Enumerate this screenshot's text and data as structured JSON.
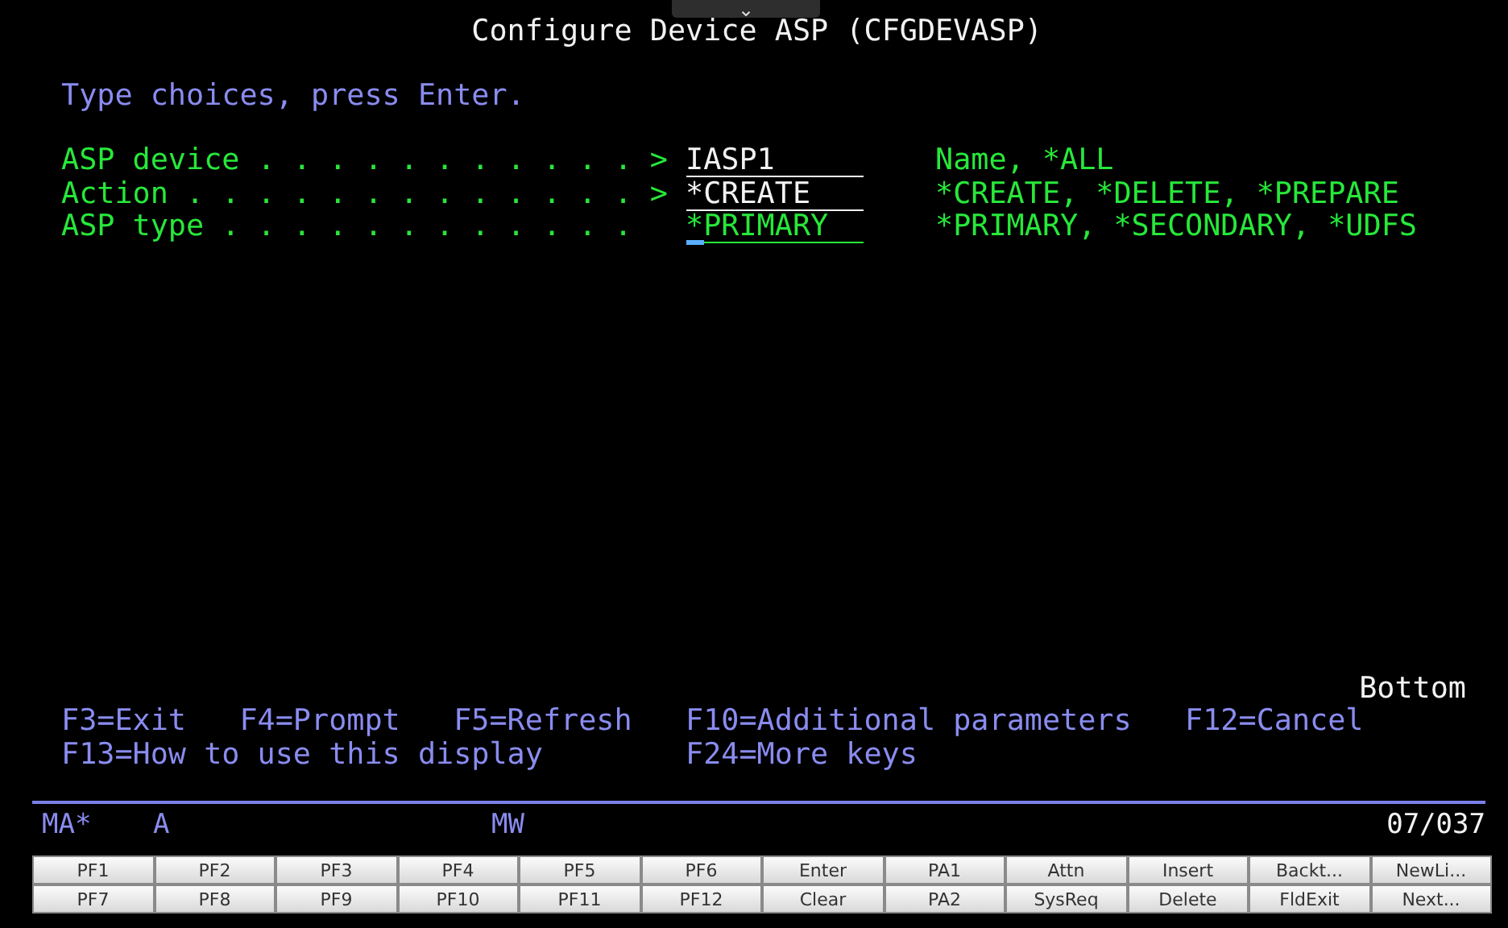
{
  "top_tab": {
    "icon": "⌄"
  },
  "title": "Configure Device ASP (CFGDEVASP)",
  "instruction": "Type choices, press Enter.",
  "fields": [
    {
      "label": "ASP device . . . . . . . . . . .",
      "prompt": ">",
      "value": "IASP1",
      "changed": true,
      "cursor": false,
      "hint": "Name, *ALL"
    },
    {
      "label": "Action . . . . . . . . . . . . .",
      "prompt": ">",
      "value": "*CREATE",
      "changed": true,
      "cursor": false,
      "hint": "*CREATE, *DELETE, *PREPARE"
    },
    {
      "label": "ASP type . . . . . . . . . . . .",
      "value": "*PRIMARY",
      "changed": false,
      "cursor": true,
      "hint": "*PRIMARY, *SECONDARY, *UDFS"
    }
  ],
  "more_indicator": "Bottom",
  "function_keys": [
    [
      "F3=Exit",
      "F4=Prompt",
      "F5=Refresh",
      "F10=Additional parameters",
      "F12=Cancel"
    ],
    [
      "F13=How to use this display",
      "F24=More keys"
    ]
  ],
  "status_bar": {
    "mode": "MA*",
    "session": "A",
    "indicator": "MW",
    "cursor_position": "07/037"
  },
  "keypad": [
    [
      "PF1",
      "PF2",
      "PF3",
      "PF4",
      "PF5",
      "PF6",
      "Enter",
      "PA1",
      "Attn",
      "Insert",
      "Backt...",
      "NewLi..."
    ],
    [
      "PF7",
      "PF8",
      "PF9",
      "PF10",
      "PF11",
      "PF12",
      "Clear",
      "PA2",
      "SysReq",
      "Delete",
      "FldExit",
      "Next..."
    ]
  ]
}
